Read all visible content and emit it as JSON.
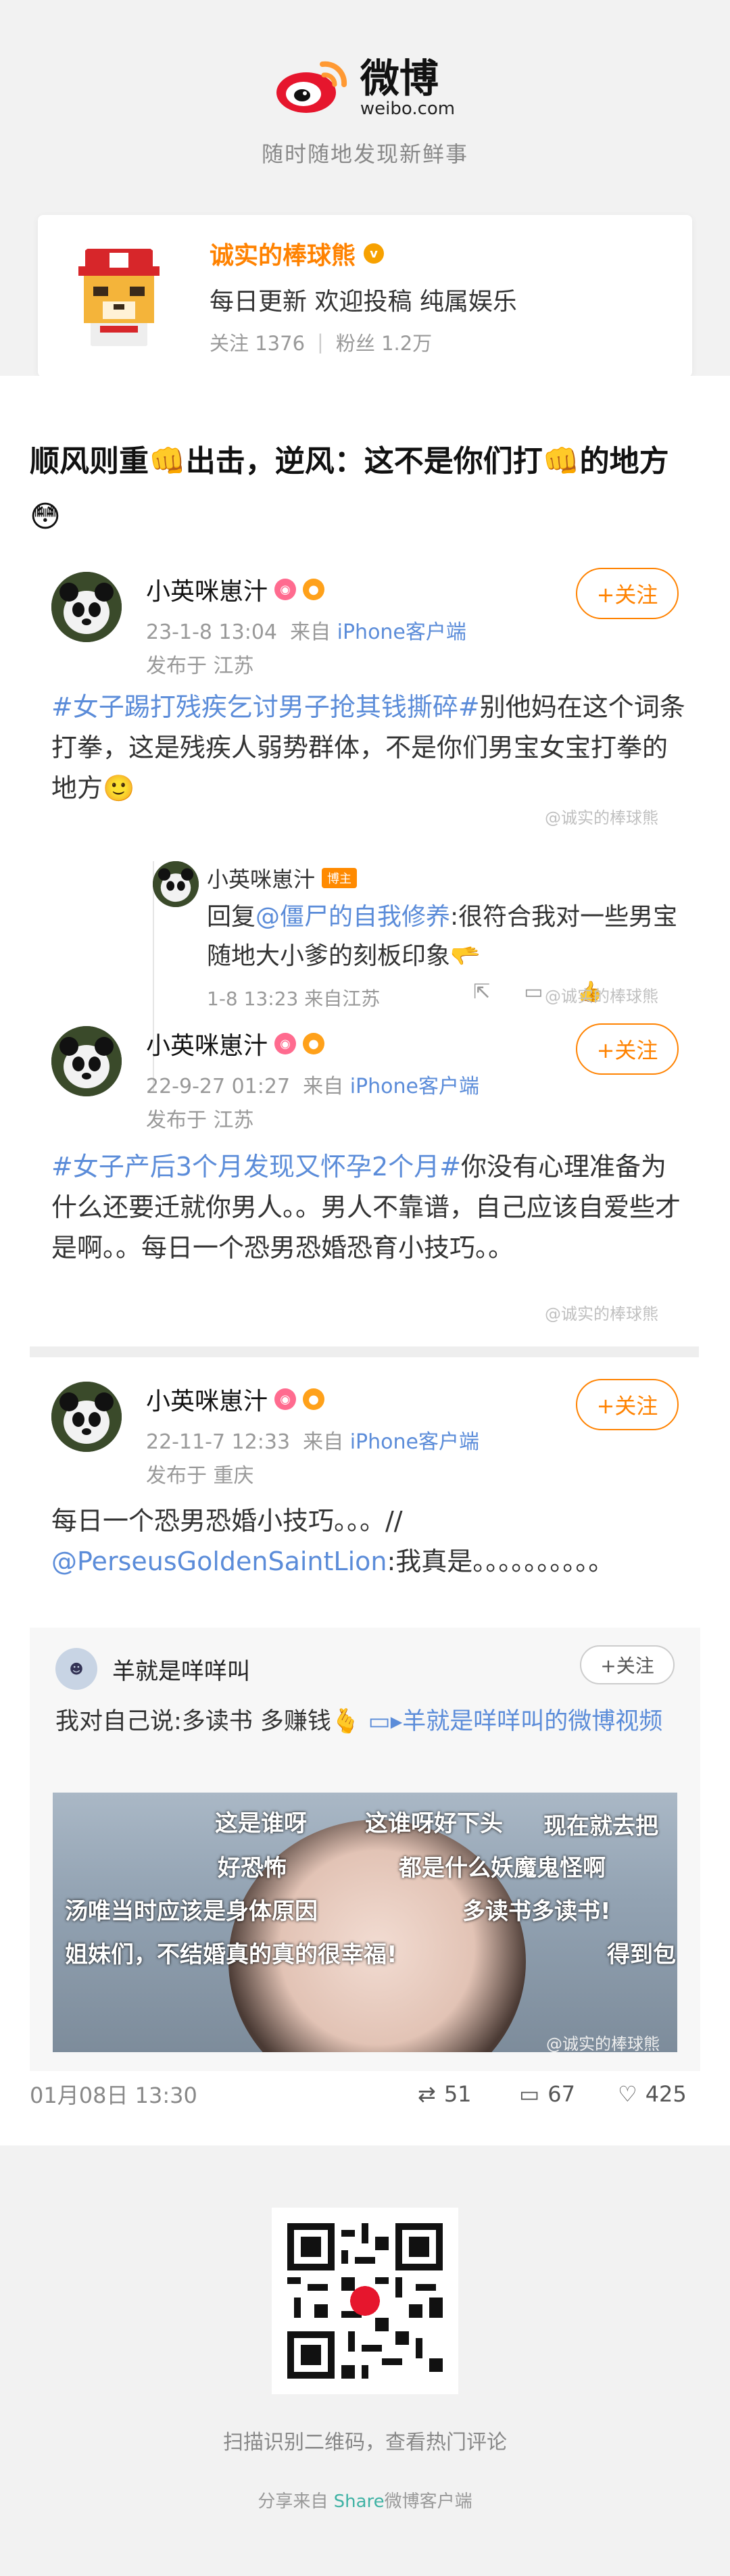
{
  "brand": {
    "name": "微博",
    "domain": "weibo.com",
    "slogan": "随时随地发现新鲜事"
  },
  "profile": {
    "name": "诚实的棒球熊",
    "bio": "每日更新  欢迎投稿  纯属娱乐",
    "following_label": "关注",
    "following_count": "1376",
    "followers_label": "粉丝",
    "followers_count": "1.2万"
  },
  "post": {
    "headline_a": "顺风则重",
    "headline_b": "出击，逆风：这不是你们打",
    "headline_c": "的地方",
    "follow_label": "+关注",
    "watermark": "@诚实的棒球熊",
    "items": [
      {
        "name": "小英咪崽汁",
        "time": "23-1-8 13:04",
        "source_prefix": "来自",
        "source": "iPhone客户端",
        "location": "发布于 江苏",
        "topic": "#女子踢打残疾乞讨男子抢其钱撕碎#",
        "text": "别他妈在这个词条打拳，这是残疾人弱势群体，不是你们男宝女宝打拳的地方🙂"
      },
      {
        "name": "小英咪崽汁",
        "time": "22-9-27 01:27",
        "source_prefix": "来自",
        "source": "iPhone客户端",
        "location": "发布于 江苏",
        "topic": "#女子产后3个月发现又怀孕2个月#",
        "text": "你没有心理准备为什么还要迁就你男人。。男人不靠谱，自己应该自爱些才是啊。。每日一个恐男恐婚恐育小技巧。。"
      },
      {
        "name": "小英咪崽汁",
        "time": "22-11-7 12:33",
        "source_prefix": "来自",
        "source": "iPhone客户端",
        "location": "发布于 重庆",
        "text_a": "每日一个恐男恐婚小技巧。。。//",
        "mention": "@PerseusGoldenSaintLion",
        "text_b": ":我真是。。。。。。。。。。"
      }
    ],
    "reply": {
      "name": "小英咪崽汁",
      "badge": "博主",
      "prefix": "回复",
      "mention": "@僵尸的自我修养",
      "text": ":很符合我对一些男宝随地大小爹的刻板印象🫳",
      "time": "1-8 13:23  来自江苏"
    },
    "repost": {
      "name": "羊就是咩咩叫",
      "follow_label": "+关注",
      "text": "我对自己说:多读书 多赚钱🫰",
      "video_link": "羊就是咩咩叫的微博视频",
      "danmaku": [
        "这是谁呀",
        "这谁呀好下头",
        "现在就去把",
        "好恐怖",
        "都是什么妖魔鬼怪啊",
        "汤唯当时应该是身体原因",
        "多读书多读书!",
        "姐妹们，不结婚真的真的很幸福!",
        "得到包"
      ]
    },
    "footer": {
      "date": "01月08日 13:30",
      "reposts": "51",
      "comments": "67",
      "likes": "425"
    }
  },
  "bottom": {
    "qr_caption": "扫描识别二维码，查看热门评论",
    "share_prefix": "分享来自",
    "share_link": "Share",
    "share_suffix": "微博客户端"
  }
}
